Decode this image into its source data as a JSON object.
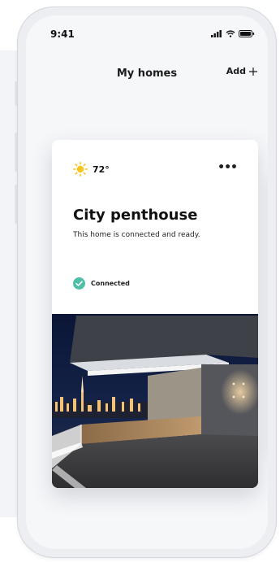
{
  "status_bar": {
    "time": "9:41"
  },
  "header": {
    "title": "My homes",
    "add_label": "Add"
  },
  "home_card": {
    "weather": {
      "temperature": "72°",
      "icon": "sun-icon"
    },
    "name": "City penthouse",
    "description": "This home is connected and ready.",
    "status": {
      "label": "Connected",
      "icon": "check-circle-icon",
      "color": "#4fbfa8"
    },
    "photo": {
      "icon": "rooftop-photo"
    }
  },
  "colors": {
    "accent_check": "#4fbfa8",
    "sun": "#f7c51e",
    "screen_bg": "#f6f7f9"
  }
}
